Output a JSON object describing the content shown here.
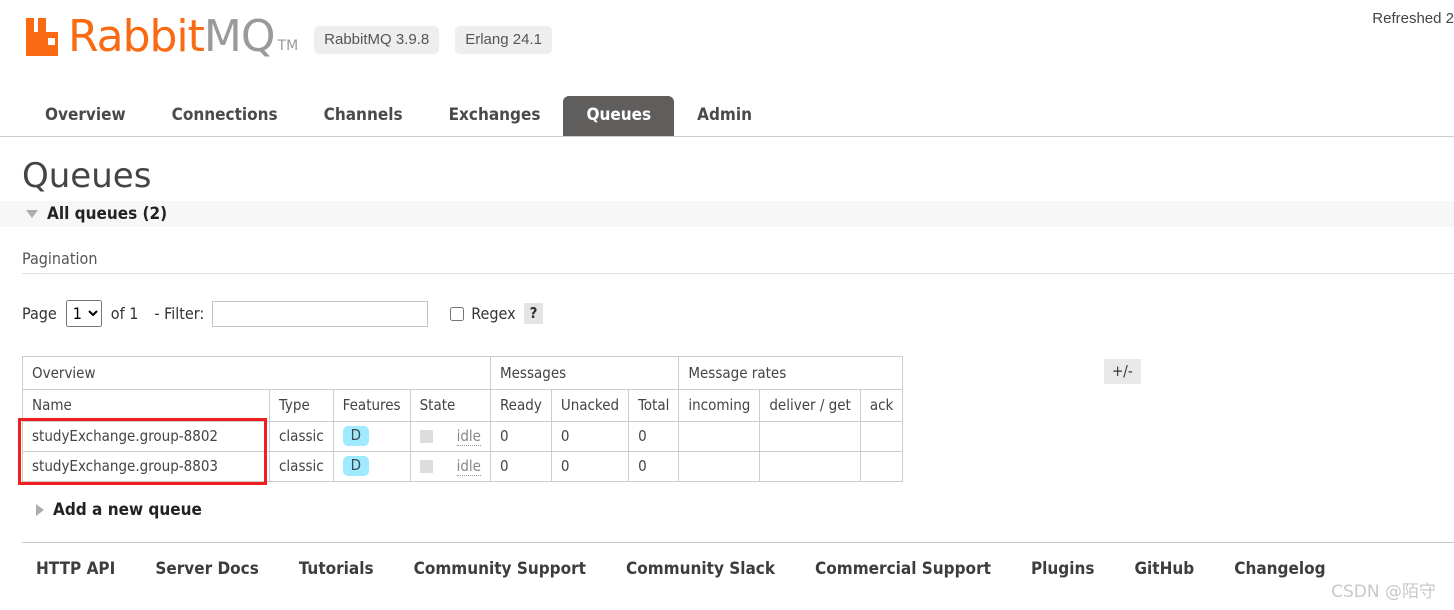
{
  "header": {
    "refreshed_status": "Refreshed 2",
    "logo": {
      "mark_icon": "rabbit-logo-icon",
      "word_primary": "Rabbit",
      "word_secondary": "MQ",
      "trademark": "TM"
    },
    "badges": [
      {
        "label": "RabbitMQ 3.9.8"
      },
      {
        "label": "Erlang 24.1"
      }
    ]
  },
  "tabs": [
    {
      "label": "Overview",
      "active": false
    },
    {
      "label": "Connections",
      "active": false
    },
    {
      "label": "Channels",
      "active": false
    },
    {
      "label": "Exchanges",
      "active": false
    },
    {
      "label": "Queues",
      "active": true
    },
    {
      "label": "Admin",
      "active": false
    }
  ],
  "page": {
    "title": "Queues",
    "all_queues_label": "All queues (2)",
    "expander_down_icon": "triangle-down-icon",
    "expander_right_icon": "triangle-right-icon"
  },
  "pagination": {
    "section_label": "Pagination",
    "page_label": "Page",
    "page_value": "1",
    "page_options": [
      "1"
    ],
    "of_label": "of 1",
    "filter_label": "- Filter:",
    "filter_value": "",
    "filter_placeholder": "",
    "regex_label": "Regex",
    "regex_checked": false,
    "regex_help_label": "?"
  },
  "table": {
    "group_headers": [
      {
        "label": "Overview",
        "span": 4
      },
      {
        "label": "Messages",
        "span": 3
      },
      {
        "label": "Message rates",
        "span": 3
      }
    ],
    "columns": [
      {
        "label": "Name",
        "sortable": true,
        "align": "left"
      },
      {
        "label": "Type",
        "sortable": true,
        "align": "left"
      },
      {
        "label": "Features",
        "sortable": false,
        "align": "left"
      },
      {
        "label": "State",
        "sortable": true,
        "align": "left"
      },
      {
        "label": "Ready",
        "sortable": true,
        "align": "right"
      },
      {
        "label": "Unacked",
        "sortable": true,
        "align": "right"
      },
      {
        "label": "Total",
        "sortable": true,
        "align": "right"
      },
      {
        "label": "incoming",
        "sortable": true,
        "align": "left"
      },
      {
        "label": "deliver / get",
        "sortable": true,
        "align": "left"
      },
      {
        "label": "ack",
        "sortable": true,
        "align": "left"
      }
    ],
    "rows": [
      {
        "name": "studyExchange.group-8802",
        "type": "classic",
        "feature_badge": "D",
        "state": "idle",
        "ready": "0",
        "unacked": "0",
        "total": "0",
        "incoming": "",
        "deliver_get": "",
        "ack": ""
      },
      {
        "name": "studyExchange.group-8803",
        "type": "classic",
        "feature_badge": "D",
        "state": "idle",
        "ready": "0",
        "unacked": "0",
        "total": "0",
        "incoming": "",
        "deliver_get": "",
        "ack": ""
      }
    ],
    "plus_minus_label": "+/-"
  },
  "add_queue": {
    "label": "Add a new queue"
  },
  "footer": {
    "links": [
      {
        "label": "HTTP API"
      },
      {
        "label": "Server Docs"
      },
      {
        "label": "Tutorials"
      },
      {
        "label": "Community Support"
      },
      {
        "label": "Community Slack"
      },
      {
        "label": "Commercial Support"
      },
      {
        "label": "Plugins"
      },
      {
        "label": "GitHub"
      },
      {
        "label": "Changelog"
      }
    ]
  },
  "watermark": {
    "text": "CSDN @陌守"
  },
  "colors": {
    "brand_orange": "#f96a12",
    "active_tab_bg": "#605e5c",
    "feature_badge_bg": "#a0eaff",
    "annotation_red": "#f02020",
    "row_alt_bg": "#e6e6e6"
  }
}
